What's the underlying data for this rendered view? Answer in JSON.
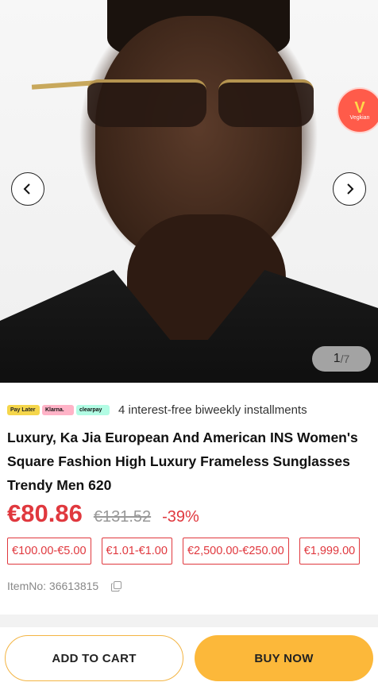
{
  "gallery": {
    "current": "1",
    "separator": "/",
    "total": "7",
    "prev_icon": "chevron-left-icon",
    "next_icon": "chevron-right-icon"
  },
  "promo_badge": {
    "letter": "V",
    "text": "Vegkian"
  },
  "payment": {
    "badges": [
      "Pay Later",
      "Klarna.",
      "clearpay"
    ],
    "text": "4 interest-free biweekly installments"
  },
  "product": {
    "title": "Luxury, Ka Jia European And American INS Women's Square Fashion High Luxury Frameless Sunglasses Trendy Men 620",
    "price": "€80.86",
    "old_price": "€131.52",
    "discount": "-39%",
    "item_no": "ItemNo: 36613815"
  },
  "coupons": [
    "€100.00-€5.00",
    "€1.01-€1.00",
    "€2,500.00-€250.00",
    "€1,999.00"
  ],
  "actions": {
    "add_to_cart": "ADD TO CART",
    "buy_now": "BUY NOW"
  },
  "colors": {
    "accent": "#e0383e",
    "buy": "#fcb83a"
  }
}
